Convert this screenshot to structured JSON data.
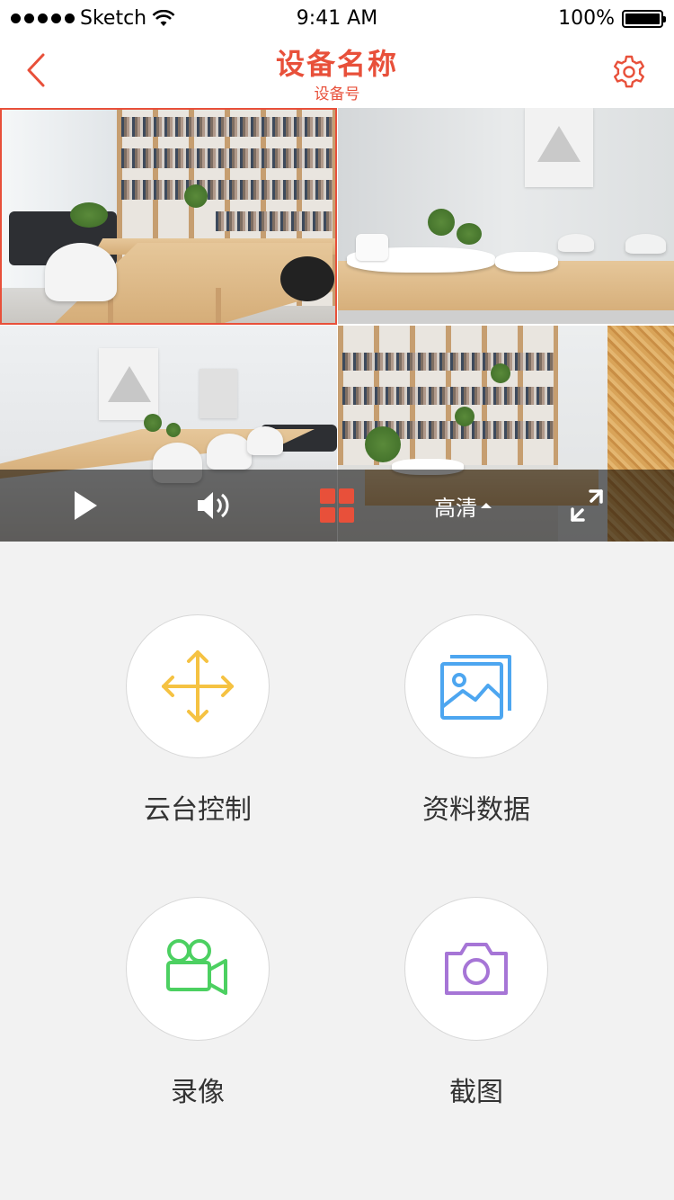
{
  "status_bar": {
    "carrier": "Sketch",
    "time": "9:41 AM",
    "battery": "100%"
  },
  "nav": {
    "title": "设备名称",
    "subtitle": "设备号",
    "back_icon": "chevron-left-icon",
    "settings_icon": "gear-icon"
  },
  "video": {
    "selected_cell": 1,
    "controls": {
      "play_icon": "play-icon",
      "volume_icon": "speaker-icon",
      "layout_icon": "grid-layout-icon",
      "quality_label": "高清",
      "fullscreen_icon": "fullscreen-icon"
    }
  },
  "features": [
    {
      "label": "云台控制",
      "icon": "pan-tilt-arrows-icon",
      "color": "#f5c242"
    },
    {
      "label": "资料数据",
      "icon": "image-gallery-icon",
      "color": "#4da6f0"
    },
    {
      "label": "录像",
      "icon": "video-camera-icon",
      "color": "#4cd061"
    },
    {
      "label": "截图",
      "icon": "camera-icon",
      "color": "#a675d6"
    }
  ],
  "colors": {
    "accent": "#e8503a",
    "background": "#f2f2f2"
  }
}
